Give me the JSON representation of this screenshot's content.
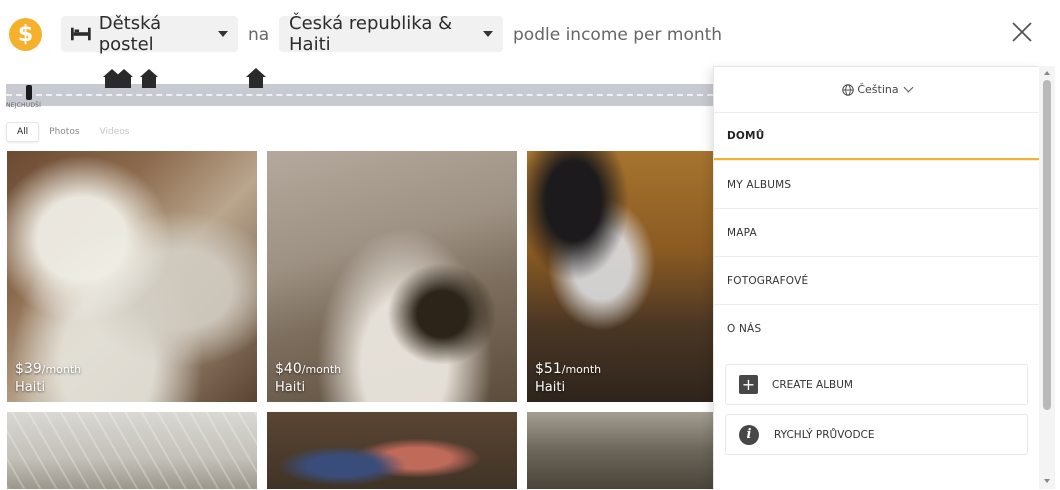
{
  "header": {
    "logo_glyph": "$",
    "thing": "Dětská postel",
    "word_na": "na",
    "place": "Česká republika & Haiti",
    "word_by": "podle income per month"
  },
  "income_strip": {
    "poorest_label": "NEJCHUDŠÍ"
  },
  "tabs": [
    {
      "label": "All"
    },
    {
      "label": "Photos"
    },
    {
      "label": "Videos"
    }
  ],
  "photos": [
    {
      "price": "$39",
      "unit": "/month",
      "country": "Haiti"
    },
    {
      "price": "$40",
      "unit": "/month",
      "country": "Haiti"
    },
    {
      "price": "$51",
      "unit": "/month",
      "country": "Haiti"
    }
  ],
  "menu": {
    "language": "Čeština",
    "items": [
      {
        "label": "DOMŮ"
      },
      {
        "label": "MY ALBUMS"
      },
      {
        "label": "MAPA"
      },
      {
        "label": "FOTOGRAFOVÉ"
      },
      {
        "label": "O NÁS"
      }
    ],
    "create_album": "CREATE ALBUM",
    "quick_guide": "RYCHLÝ PRŮVODCE"
  },
  "colors": {
    "accent": "#f5b12b",
    "icon_dark": "#474747"
  }
}
